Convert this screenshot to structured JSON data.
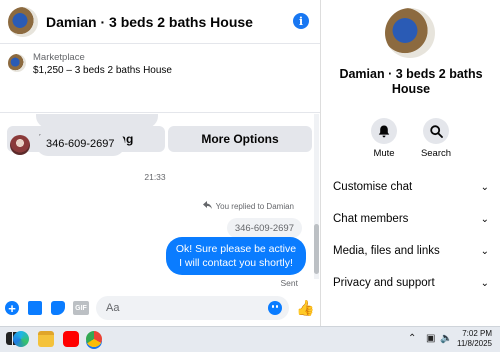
{
  "header": {
    "title": "Damian · 3 beds 2 baths House",
    "info_icon": "i"
  },
  "marketplace": {
    "label": "Marketplace",
    "listing": "$1,250 – 3 beds 2 baths House"
  },
  "actions": {
    "pending": "Mark as pending",
    "more": "More Options"
  },
  "messages": {
    "incoming_phone": "346-609-2697",
    "timestamp": "21:33",
    "replied_label": "You replied to Damian",
    "quoted": "346-609-2697",
    "outgoing": "Ok! Sure please be active I will contact you shortly!",
    "status": "Sent"
  },
  "composer": {
    "placeholder": "Aa",
    "gif": "GIF",
    "plus": "+"
  },
  "profile": {
    "title": "Damian · 3 beds 2 baths House",
    "mute": "Mute",
    "search": "Search",
    "menu": [
      "Customise chat",
      "Chat members",
      "Media, files and links",
      "Privacy and support"
    ]
  },
  "taskbar": {
    "time": "7:02 PM",
    "date": "11/8/2025"
  },
  "colors": {
    "accent": "#0a7cff",
    "bubble_in": "#e4e6eb"
  }
}
